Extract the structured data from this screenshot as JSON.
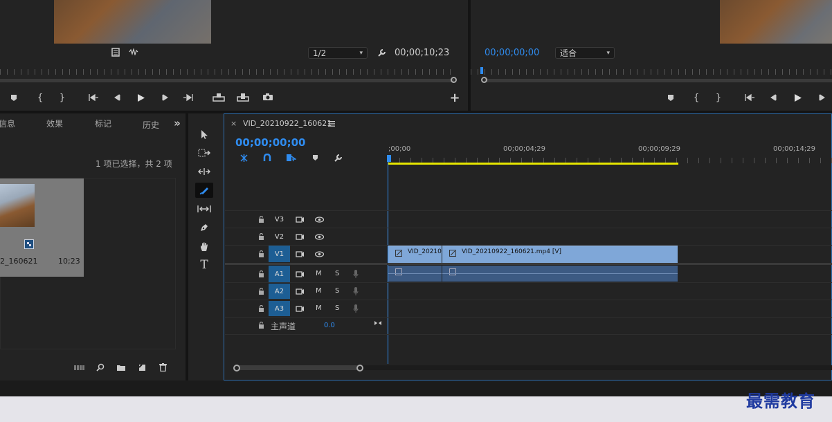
{
  "source_monitor": {
    "resolution_value": "1/2",
    "timecode": "00;00;10;23"
  },
  "program_monitor": {
    "timecode": "00;00;00;00",
    "zoom_value": "适合"
  },
  "project_panel": {
    "tabs": [
      "信息",
      "效果",
      "标记",
      "历史"
    ],
    "overflow_icon": "double-chevron-right-icon",
    "selection_status": "1 项已选择，共 2 项",
    "item": {
      "name": "2_160621",
      "duration": "10;23"
    }
  },
  "tools": [
    "selection-tool",
    "track-select-tool",
    "ripple-edit-tool",
    "razor-tool",
    "slip-tool",
    "pen-tool",
    "hand-tool",
    "type-tool"
  ],
  "timeline": {
    "close_symbol": "×",
    "sequence_name": "VID_20210922_160621",
    "menu_icon": "hamburger-menu-icon",
    "playhead_timecode": "00;00;00;00",
    "ruler_labels": [
      ";00;00",
      "00;00;04;29",
      "00;00;09;29",
      "00;00;14;29"
    ],
    "video_tracks": [
      {
        "id": "V3",
        "active": false
      },
      {
        "id": "V2",
        "active": false
      },
      {
        "id": "V1",
        "active": true
      }
    ],
    "audio_tracks": [
      {
        "id": "A1",
        "mute": "M",
        "solo": "S"
      },
      {
        "id": "A2",
        "mute": "M",
        "solo": "S"
      },
      {
        "id": "A3",
        "mute": "M",
        "solo": "S"
      }
    ],
    "master": {
      "label": "主声道",
      "value": "0.0"
    },
    "clips": {
      "v1_first": "VID_20210",
      "v1_second": "VID_20210922_160621.mp4 [V]"
    }
  },
  "watermark": "最需教育",
  "colors": {
    "accent_blue": "#2f8cf0",
    "track_active": "#1d5e94",
    "video_clip": "#7fa7d8",
    "audio_clip": "#3c5a83",
    "work_area": "#e6e600"
  }
}
